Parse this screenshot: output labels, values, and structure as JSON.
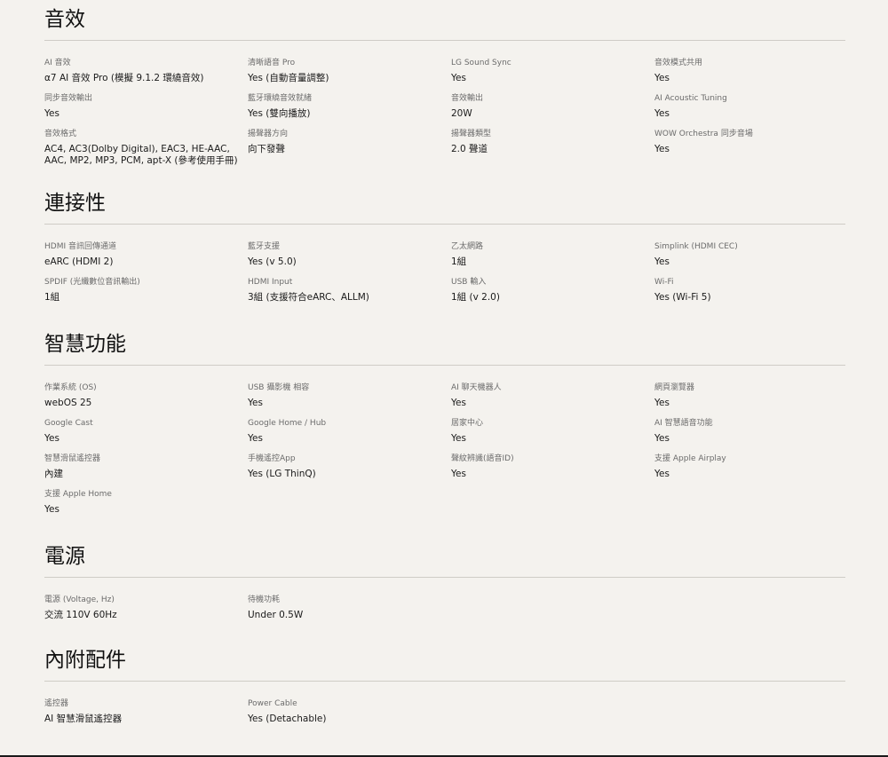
{
  "sections": [
    {
      "title": "音效",
      "specs": [
        {
          "label": "AI 音效",
          "value": "α7 AI 音效 Pro (模擬 9.1.2 環繞音效)"
        },
        {
          "label": "清晰語音 Pro",
          "value": "Yes (自動音量調整)"
        },
        {
          "label": "LG Sound Sync",
          "value": "Yes"
        },
        {
          "label": "音效模式共用",
          "value": "Yes"
        },
        {
          "label": "同步音效輸出",
          "value": "Yes"
        },
        {
          "label": "藍牙環繞音效就緒",
          "value": "Yes (雙向播放)"
        },
        {
          "label": "音效輸出",
          "value": "20W"
        },
        {
          "label": "AI Acoustic Tuning",
          "value": "Yes"
        },
        {
          "label": "音效格式",
          "value": "AC4, AC3(Dolby Digital), EAC3, HE-AAC, AAC, MP2, MP3, PCM, apt-X (參考使用手冊)"
        },
        {
          "label": "揚聲器方向",
          "value": "向下發聲"
        },
        {
          "label": "揚聲器類型",
          "value": "2.0 聲道"
        },
        {
          "label": "WOW Orchestra 同步音場",
          "value": "Yes"
        }
      ]
    },
    {
      "title": "連接性",
      "specs": [
        {
          "label": "HDMI 音訊回傳通道",
          "value": "eARC (HDMI 2)"
        },
        {
          "label": "藍牙支援",
          "value": "Yes (v 5.0)"
        },
        {
          "label": "乙太網路",
          "value": "1組"
        },
        {
          "label": "Simplink (HDMI CEC)",
          "value": "Yes"
        },
        {
          "label": "SPDIF (光纖數位音訊輸出)",
          "value": "1組"
        },
        {
          "label": "HDMI Input",
          "value": "3組 (支援符合eARC、ALLM)"
        },
        {
          "label": "USB 輸入",
          "value": "1組 (v 2.0)"
        },
        {
          "label": "Wi-Fi",
          "value": "Yes (Wi-Fi 5)"
        }
      ]
    },
    {
      "title": "智慧功能",
      "specs": [
        {
          "label": "作業系統 (OS)",
          "value": "webOS 25"
        },
        {
          "label": "USB 攝影機 相容",
          "value": "Yes"
        },
        {
          "label": "AI 聊天機器人",
          "value": "Yes"
        },
        {
          "label": "網頁瀏覽器",
          "value": "Yes"
        },
        {
          "label": "Google Cast",
          "value": "Yes"
        },
        {
          "label": "Google Home / Hub",
          "value": "Yes"
        },
        {
          "label": "居家中心",
          "value": "Yes"
        },
        {
          "label": "AI 智慧語音功能",
          "value": "Yes"
        },
        {
          "label": "智慧滑鼠遙控器",
          "value": "內建"
        },
        {
          "label": "手機遙控App",
          "value": "Yes (LG ThinQ)"
        },
        {
          "label": "聲紋辨識(語音ID)",
          "value": "Yes"
        },
        {
          "label": "支援 Apple Airplay",
          "value": "Yes"
        },
        {
          "label": "支援 Apple Home",
          "value": "Yes"
        }
      ]
    },
    {
      "title": "電源",
      "specs": [
        {
          "label": "電源 (Voltage, Hz)",
          "value": "交流 110V 60Hz"
        },
        {
          "label": "待機功耗",
          "value": "Under 0.5W"
        }
      ]
    },
    {
      "title": "內附配件",
      "specs": [
        {
          "label": "遙控器",
          "value": "AI 智慧滑鼠遙控器"
        },
        {
          "label": "Power Cable",
          "value": "Yes (Detachable)"
        }
      ]
    }
  ]
}
